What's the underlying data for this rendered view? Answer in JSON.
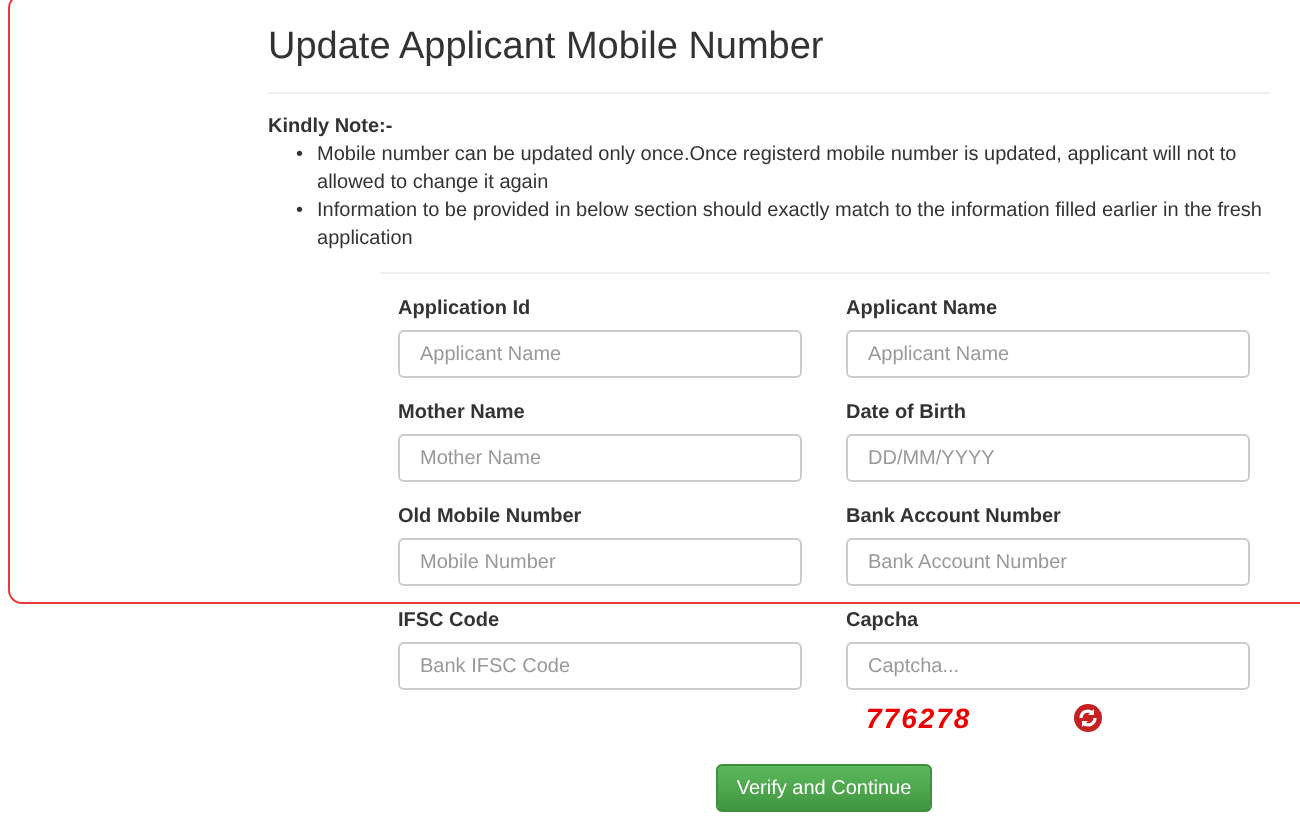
{
  "title": "Update Applicant Mobile Number",
  "note": {
    "heading": "Kindly Note:-",
    "items": [
      {
        "marker": "•",
        "text": "Mobile number can be updated only once.Once registerd mobile number is updated, applicant will not to allowed to change it again"
      },
      {
        "marker": "•",
        "text": "Information to be provided in below section should exactly match to the information filled earlier in the fresh application"
      }
    ]
  },
  "fields": [
    {
      "label": "Application Id",
      "placeholder": "Applicant Name"
    },
    {
      "label": "Applicant Name",
      "placeholder": "Applicant Name"
    },
    {
      "label": "Mother Name",
      "placeholder": "Mother Name"
    },
    {
      "label": "Date of Birth",
      "placeholder": "DD/MM/YYYY"
    },
    {
      "label": "Old Mobile Number",
      "placeholder": "Mobile Number"
    },
    {
      "label": "Bank Account Number",
      "placeholder": "Bank Account Number"
    },
    {
      "label": "IFSC Code",
      "placeholder": "Bank IFSC Code"
    },
    {
      "label": "Capcha",
      "placeholder": "Captcha..."
    }
  ],
  "captcha": {
    "text": "776278"
  },
  "submit": "Verify and Continue"
}
